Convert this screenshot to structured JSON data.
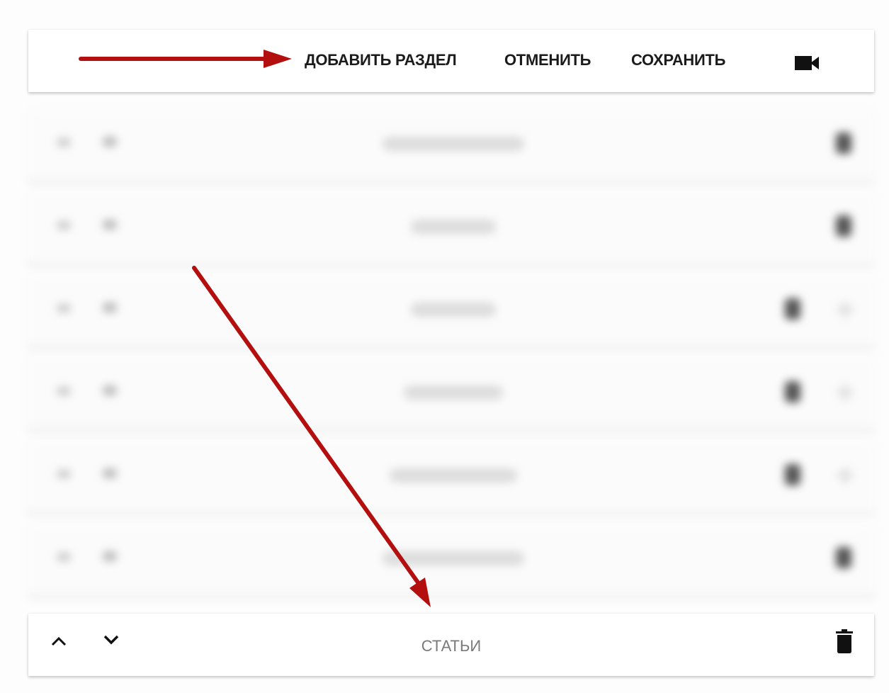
{
  "toolbar": {
    "add_section_label": "ДОБАВИТЬ РАЗДЕЛ",
    "cancel_label": "ОТМЕНИТЬ",
    "save_label": "СОХРАНИТЬ",
    "video_icon": "video-camera-icon"
  },
  "blurred_rows": [
    {
      "actions": [
        "delete"
      ]
    },
    {
      "actions": [
        "delete"
      ]
    },
    {
      "actions": [
        "delete",
        "add"
      ]
    },
    {
      "actions": [
        "delete",
        "add"
      ]
    },
    {
      "actions": [
        "delete",
        "add"
      ]
    },
    {
      "actions": [
        "delete"
      ]
    }
  ],
  "section_row": {
    "title": "СТАТЬИ",
    "move_up_icon": "chevron-up-icon",
    "move_down_icon": "chevron-down-icon",
    "delete_icon": "trash-icon"
  },
  "colors": {
    "annotation_arrow": "#b30f0f",
    "text_dark": "#1b1b1b",
    "title_gray": "#7a7a7a"
  }
}
